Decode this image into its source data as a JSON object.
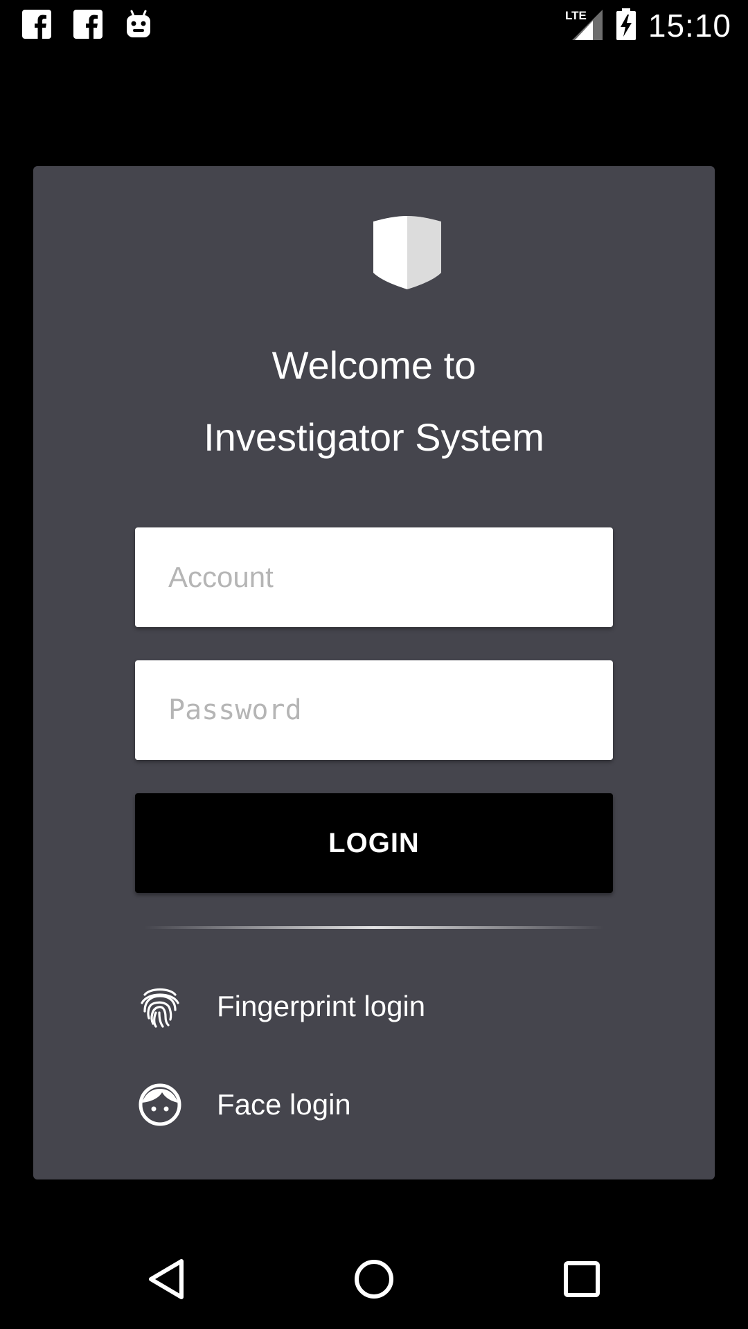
{
  "status_bar": {
    "time": "15:10",
    "network": "LTE",
    "left_icons": [
      "facebook-icon",
      "facebook-icon",
      "android-icon"
    ],
    "right_icons": [
      "lte-signal-icon",
      "battery-charging-icon"
    ]
  },
  "login_card": {
    "logo": "shield-icon",
    "title_line1": "Welcome to",
    "title_line2": "Investigator System",
    "account_placeholder": "Account",
    "password_placeholder": "Password",
    "login_label": "LOGIN",
    "fingerprint_label": "Fingerprint login",
    "fingerprint_icon": "fingerprint-icon",
    "face_label": "Face login",
    "face_icon": "face-icon"
  },
  "nav_bar": {
    "buttons": [
      "back-icon",
      "home-icon",
      "recents-icon"
    ]
  },
  "colors": {
    "background": "#000000",
    "card": "#45454d",
    "text": "#ffffff",
    "field": "#ffffff",
    "placeholder": "#b5b5b5",
    "button": "#000000"
  }
}
